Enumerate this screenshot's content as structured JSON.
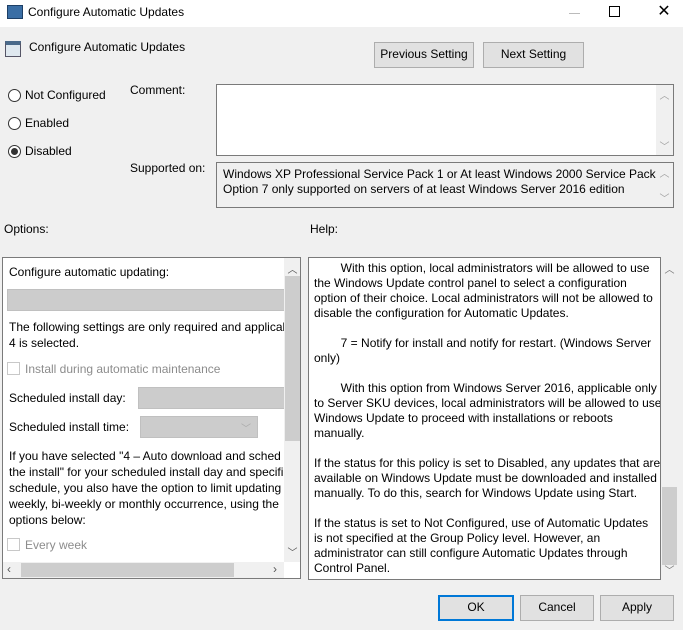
{
  "window": {
    "title": "Configure Automatic Updates",
    "controls": [
      "minimize",
      "maximize",
      "close"
    ]
  },
  "header": {
    "title": "Configure Automatic Updates",
    "previous_label": "Previous Setting",
    "next_label": "Next Setting"
  },
  "state": {
    "options": [
      {
        "label": "Not Configured",
        "selected": false
      },
      {
        "label": "Enabled",
        "selected": false
      },
      {
        "label": "Disabled",
        "selected": true
      }
    ]
  },
  "comment": {
    "label": "Comment:",
    "value": ""
  },
  "supported": {
    "label": "Supported on:",
    "lines": [
      "Windows XP Professional Service Pack 1 or At least Windows 2000 Service Pack 3",
      "Option 7 only supported on servers of at least Windows Server 2016 edition"
    ]
  },
  "options_panel": {
    "label": "Options:",
    "configure_label": "Configure automatic updating:",
    "configure_value": "",
    "note_lines": [
      "The following settings are only required and applical",
      "4 is selected."
    ],
    "install_maintenance": "Install during automatic maintenance",
    "day_label": "Scheduled install day:",
    "day_value": "",
    "time_label": "Scheduled install time:",
    "time_value": "",
    "para_lines": [
      "If you have selected \"4 – Auto download and sched",
      "the install\" for your scheduled install day and specifi",
      "schedule, you also have the option to limit updating",
      "weekly, bi-weekly or monthly occurrence, using the",
      "options below:"
    ],
    "every_week": "Every week"
  },
  "help_panel": {
    "label": "Help:",
    "lines": [
      "        With this option, local administrators will be allowed to use",
      "the Windows Update control panel to select a configuration",
      "option of their choice. Local administrators will not be allowed to",
      "disable the configuration for Automatic Updates.",
      "",
      "        7 = Notify for install and notify for restart. (Windows Server",
      "only)",
      "",
      "        With this option from Windows Server 2016, applicable only",
      "to Server SKU devices, local administrators will be allowed to use",
      "Windows Update to proceed with installations or reboots",
      "manually.",
      "",
      "If the status for this policy is set to Disabled, any updates that are",
      "available on Windows Update must be downloaded and installed",
      "manually. To do this, search for Windows Update using Start.",
      "",
      "If the status is set to Not Configured, use of Automatic Updates",
      "is not specified at the Group Policy level. However, an",
      "administrator can still configure Automatic Updates through",
      "Control Panel."
    ]
  },
  "footer": {
    "ok": "OK",
    "cancel": "Cancel",
    "apply": "Apply"
  }
}
